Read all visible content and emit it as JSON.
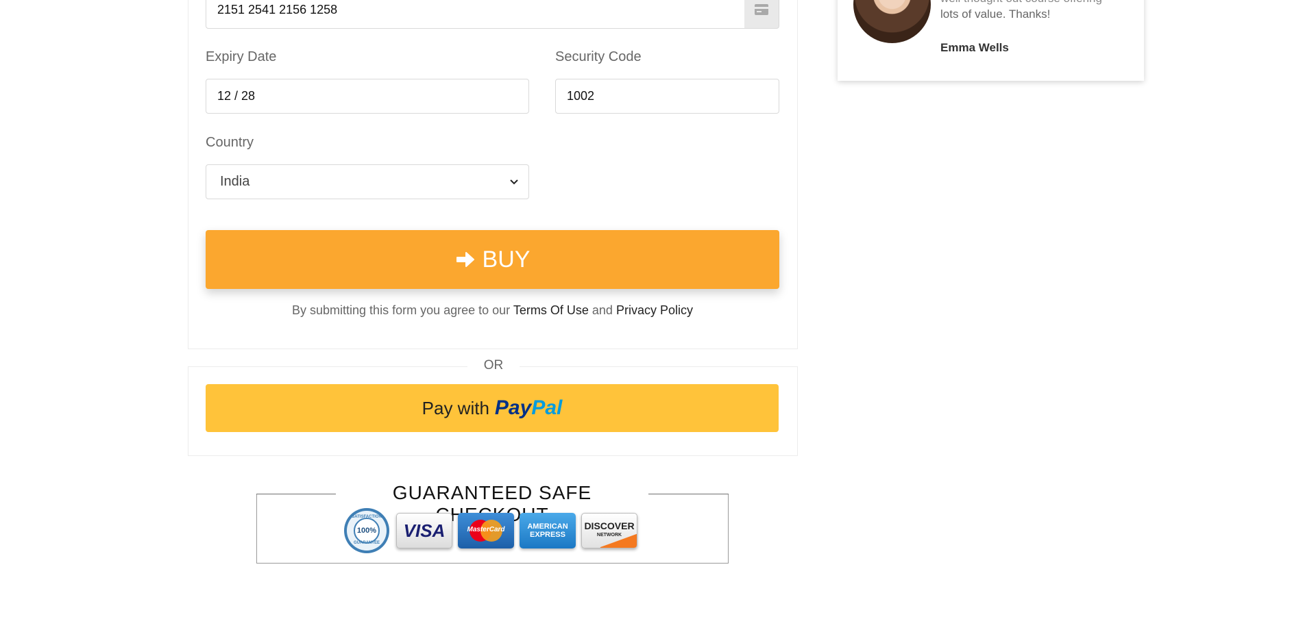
{
  "payment": {
    "card_number": "2151 2541 2156 1258",
    "card_icon": "credit-card-icon",
    "expiry_label": "Expiry Date",
    "expiry_value": "12 / 28",
    "security_label": "Security Code",
    "security_value": "1002",
    "country_label": "Country",
    "country_value": "India",
    "buy_label": "BUY",
    "buy_icon": "arrow-right-icon",
    "accent_color": "#fba72f"
  },
  "terms": {
    "prefix": "By submitting this form you agree to our",
    "terms_link": "Terms Of Use",
    "and": "and",
    "privacy_link": "Privacy Policy"
  },
  "alt_payment": {
    "or_text": "OR",
    "paypal_prefix": "Pay with",
    "paypal_pay": "Pay",
    "paypal_pal": "Pal",
    "paypal_color": "#ffc33a"
  },
  "trust_badge": {
    "title": "GUARANTEED SAFE CHECKOUT",
    "seal_top": "SATISFACTION",
    "seal_value": "100%",
    "seal_bottom": "GUARANTEE",
    "cards": {
      "visa": "VISA",
      "mastercard": "MasterCard",
      "amex_1": "AMERICAN",
      "amex_2": "EXPRESS",
      "discover_1": "DISCOVER",
      "discover_2": "NETWORK"
    }
  },
  "testimonial": {
    "quote_top": "well thought out course offering",
    "quote_line": "lots of value. Thanks!",
    "author": "Emma Wells"
  }
}
